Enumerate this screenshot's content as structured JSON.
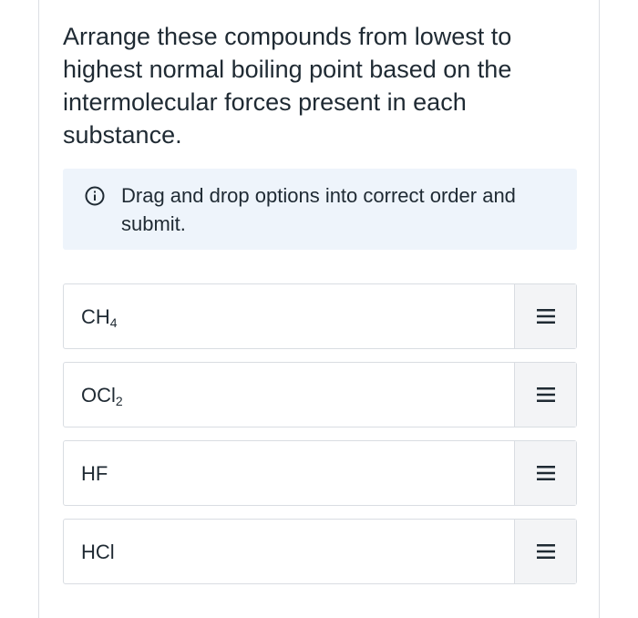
{
  "question": {
    "text": "Arrange these compounds from lowest to highest normal boiling point based on the intermolecular forces present in each substance."
  },
  "instruction": {
    "icon": "info-icon",
    "text": "Drag and drop options into correct order and submit."
  },
  "options": [
    {
      "base": "CH",
      "sub": "4",
      "handle_icon": "drag-handle-icon"
    },
    {
      "base": "OCl",
      "sub": "2",
      "handle_icon": "drag-handle-icon"
    },
    {
      "base": "HF",
      "sub": "",
      "handle_icon": "drag-handle-icon"
    },
    {
      "base": "HCl",
      "sub": "",
      "handle_icon": "drag-handle-icon"
    }
  ],
  "colors": {
    "text": "#1f2a33",
    "info_background": "#eef4fb",
    "border": "#d9dde2",
    "handle_background": "#f3f4f6"
  }
}
